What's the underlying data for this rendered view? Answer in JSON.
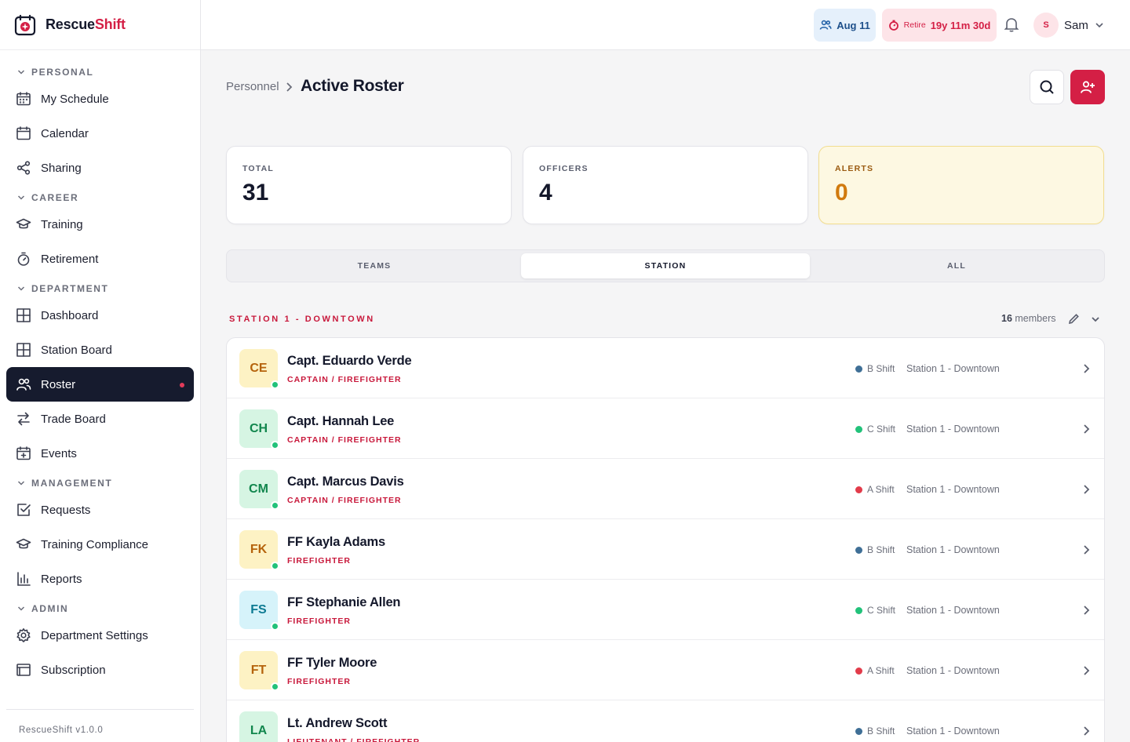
{
  "brand": {
    "part1": "Rescue",
    "part2": "Shift"
  },
  "sidebar": {
    "sections": [
      {
        "label": "PERSONAL",
        "items": [
          {
            "label": "My Schedule",
            "icon": "calendar-grid-icon"
          },
          {
            "label": "Calendar",
            "icon": "calendar-icon"
          },
          {
            "label": "Sharing",
            "icon": "share-icon"
          }
        ]
      },
      {
        "label": "CAREER",
        "items": [
          {
            "label": "Training",
            "icon": "graduation-cap-icon"
          },
          {
            "label": "Retirement",
            "icon": "stopwatch-icon"
          }
        ]
      },
      {
        "label": "DEPARTMENT",
        "items": [
          {
            "label": "Dashboard",
            "icon": "dashboard-icon"
          },
          {
            "label": "Station Board",
            "icon": "board-icon"
          },
          {
            "label": "Roster",
            "icon": "users-icon",
            "active": true
          },
          {
            "label": "Trade Board",
            "icon": "swap-icon"
          },
          {
            "label": "Events",
            "icon": "calendar-plus-icon"
          }
        ]
      },
      {
        "label": "MANAGEMENT",
        "items": [
          {
            "label": "Requests",
            "icon": "checkbox-icon"
          },
          {
            "label": "Training Compliance",
            "icon": "graduation-cap-icon"
          },
          {
            "label": "Reports",
            "icon": "bar-chart-icon"
          }
        ]
      },
      {
        "label": "ADMIN",
        "items": [
          {
            "label": "Department Settings",
            "icon": "gear-icon"
          },
          {
            "label": "Subscription",
            "icon": "card-icon"
          }
        ]
      }
    ],
    "version": "RescueShift v1.0.0"
  },
  "topbar": {
    "date": "Aug 11",
    "retire_label": "Retire",
    "retire_value": "19y 11m 30d",
    "user_initial": "S",
    "user_name": "Sam"
  },
  "page": {
    "breadcrumb_parent": "Personnel",
    "title": "Active Roster"
  },
  "stats": [
    {
      "label": "TOTAL",
      "value": "31"
    },
    {
      "label": "OFFICERS",
      "value": "4"
    },
    {
      "label": "ALERTS",
      "value": "0"
    }
  ],
  "tabs": [
    {
      "label": "TEAMS"
    },
    {
      "label": "STATION",
      "active": true
    },
    {
      "label": "ALL"
    }
  ],
  "group": {
    "title": "STATION 1 - DOWNTOWN",
    "member_count": "16",
    "member_suffix": "members"
  },
  "colors": {
    "brand_red": "#d41f45",
    "b_shift": "#3f6f96",
    "c_shift": "#22c27a",
    "a_shift": "#e23b4a"
  },
  "roster": [
    {
      "initials": "CE",
      "name": "Capt. Eduardo Verde",
      "role": "CAPTAIN / FIREFIGHTER",
      "shift": "B Shift",
      "station": "Station 1 - Downtown",
      "bg": "#fdf2c4",
      "fg": "#b5630c",
      "dot": "#3f6f96"
    },
    {
      "initials": "CH",
      "name": "Capt. Hannah Lee",
      "role": "CAPTAIN / FIREFIGHTER",
      "shift": "C Shift",
      "station": "Station 1 - Downtown",
      "bg": "#d6f5e3",
      "fg": "#11864d",
      "dot": "#22c27a"
    },
    {
      "initials": "CM",
      "name": "Capt. Marcus Davis",
      "role": "CAPTAIN / FIREFIGHTER",
      "shift": "A Shift",
      "station": "Station 1 - Downtown",
      "bg": "#d6f5e3",
      "fg": "#11864d",
      "dot": "#e23b4a"
    },
    {
      "initials": "FK",
      "name": "FF Kayla Adams",
      "role": "FIREFIGHTER",
      "shift": "B Shift",
      "station": "Station 1 - Downtown",
      "bg": "#fdf2c4",
      "fg": "#b5630c",
      "dot": "#3f6f96"
    },
    {
      "initials": "FS",
      "name": "FF Stephanie Allen",
      "role": "FIREFIGHTER",
      "shift": "C Shift",
      "station": "Station 1 - Downtown",
      "bg": "#d6f3fa",
      "fg": "#0c7a92",
      "dot": "#22c27a"
    },
    {
      "initials": "FT",
      "name": "FF Tyler Moore",
      "role": "FIREFIGHTER",
      "shift": "A Shift",
      "station": "Station 1 - Downtown",
      "bg": "#fdf2c4",
      "fg": "#b5630c",
      "dot": "#e23b4a"
    },
    {
      "initials": "LA",
      "name": "Lt. Andrew Scott",
      "role": "LIEUTENANT / FIREFIGHTER",
      "shift": "B Shift",
      "station": "Station 1 - Downtown",
      "bg": "#d6f5e3",
      "fg": "#11864d",
      "dot": "#3f6f96"
    }
  ]
}
